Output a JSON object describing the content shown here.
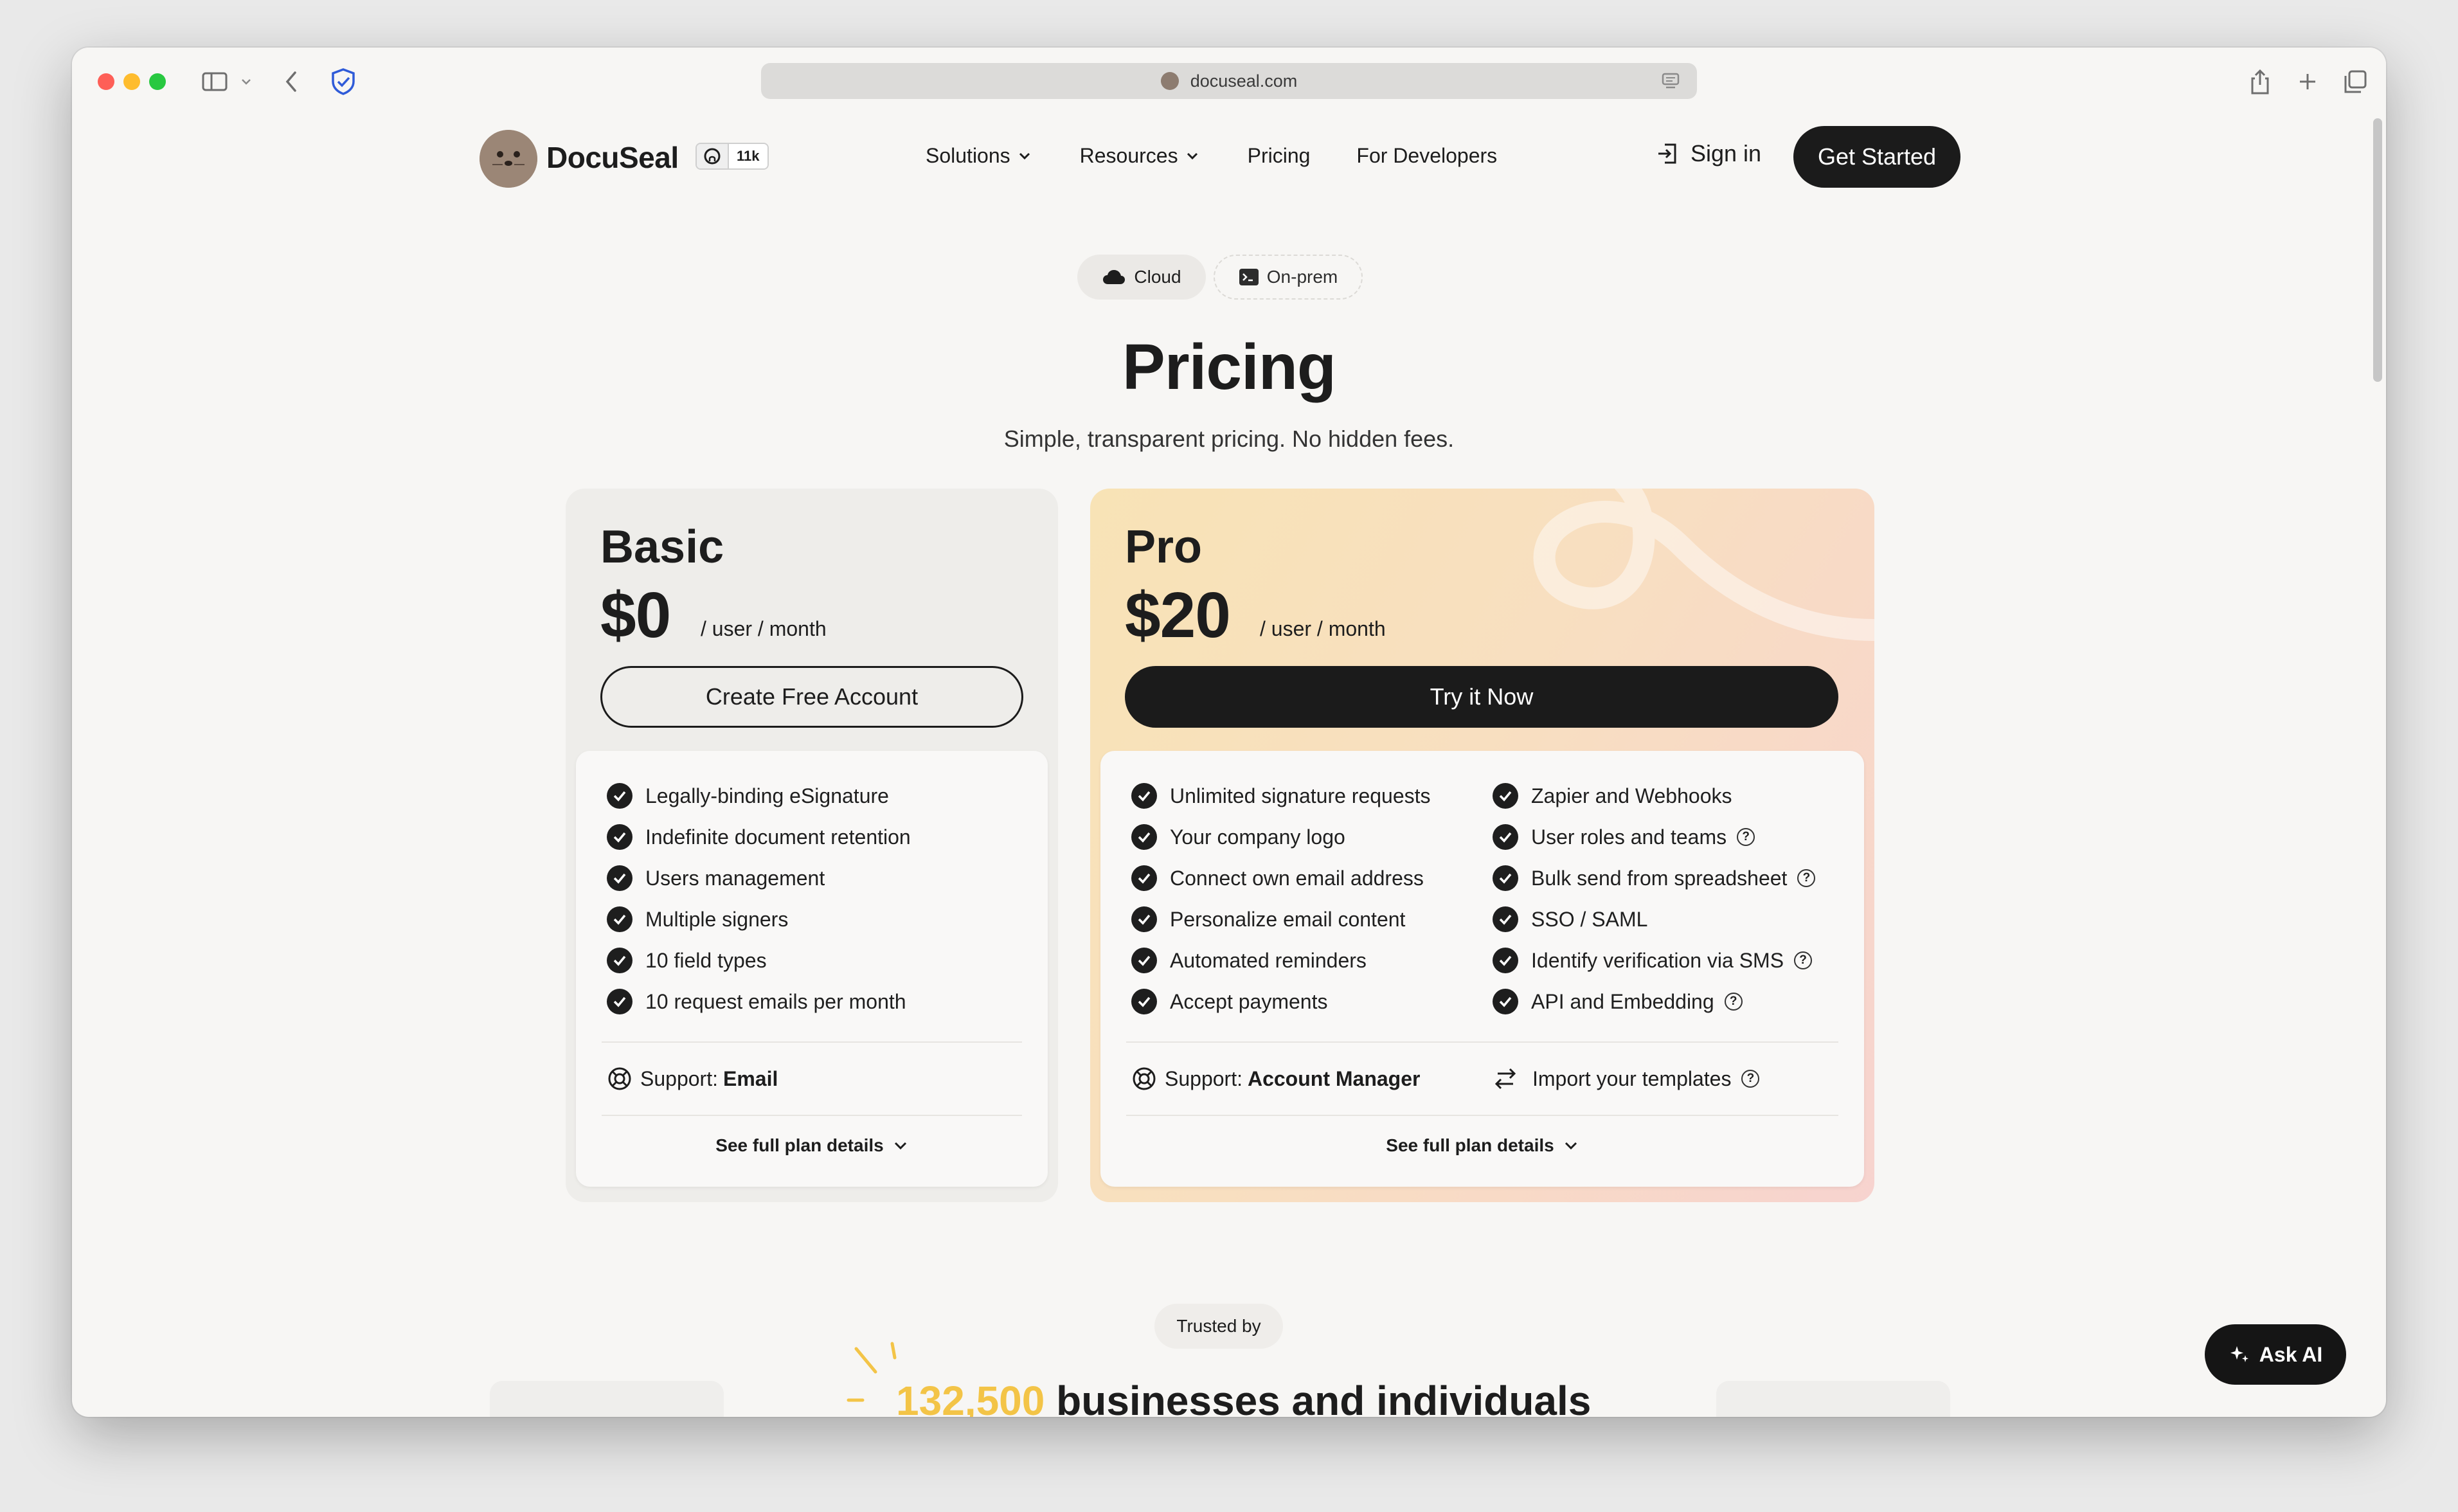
{
  "browser": {
    "url": "docuseal.com"
  },
  "nav": {
    "brand": "DocuSeal",
    "github_stars": "11k",
    "menu": [
      "Solutions",
      "Resources",
      "Pricing",
      "For Developers"
    ],
    "sign_in": "Sign in",
    "get_started": "Get Started"
  },
  "toggle": {
    "cloud": "Cloud",
    "on_prem": "On-prem",
    "selected": "Cloud"
  },
  "hero": {
    "title": "Pricing",
    "subtitle": "Simple, transparent pricing. No hidden fees."
  },
  "plans": {
    "basic": {
      "name": "Basic",
      "price": "$0",
      "per": "/ user / month",
      "cta": "Create Free Account",
      "features": [
        "Legally-binding eSignature",
        "Indefinite document retention",
        "Users management",
        "Multiple signers",
        "10 field types",
        "10 request emails per month"
      ],
      "support_label": "Support:",
      "support_value": "Email",
      "details": "See full plan details"
    },
    "pro": {
      "name": "Pro",
      "price": "$20",
      "per": "/ user / month",
      "cta": "Try it Now",
      "features_left": [
        "Unlimited signature requests",
        "Your company logo",
        "Connect own email address",
        "Personalize email content",
        "Automated reminders",
        "Accept payments"
      ],
      "features_right": [
        "Zapier and Webhooks",
        "User roles and teams",
        "Bulk send from spreadsheet",
        "SSO / SAML",
        "Identify verification via SMS",
        "API and Embedding"
      ],
      "support_label": "Support:",
      "support_value": "Account Manager",
      "import": "Import your templates",
      "details": "See full plan details"
    }
  },
  "trusted": {
    "badge": "Trusted by",
    "number": "132,500",
    "text": "businesses and individuals"
  },
  "ask_ai": "Ask AI",
  "colors": {
    "accent_dark": "#1b1b1b",
    "highlight_yellow": "#f3c447",
    "pro_gradient_start": "#f8e3b6",
    "pro_gradient_end": "#f7d3cf"
  }
}
